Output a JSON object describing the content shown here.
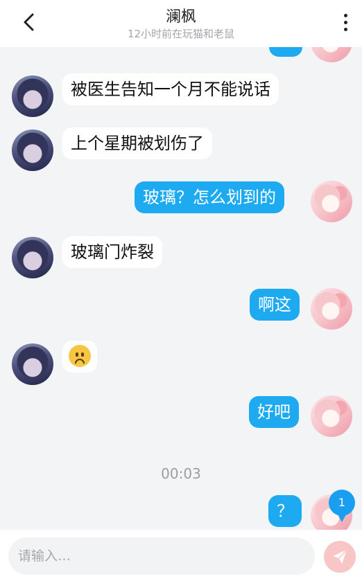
{
  "header": {
    "title": "澜枫",
    "subtitle": "12小时前在玩猫和老鼠",
    "back_icon": "chevron-left-icon",
    "more_icon": "more-vertical-icon"
  },
  "messages": [
    {
      "side": "out",
      "text": ""
    },
    {
      "side": "in",
      "text": "被医生告知一个月不能说话"
    },
    {
      "side": "in",
      "text": "上个星期被划伤了"
    },
    {
      "side": "out",
      "text": "玻璃？怎么划到的"
    },
    {
      "side": "in",
      "text": "玻璃门炸裂"
    },
    {
      "side": "out",
      "text": "啊这"
    },
    {
      "side": "in",
      "emoji": "worried-face-emoji"
    },
    {
      "side": "out",
      "text": "好吧"
    },
    {
      "side": "out",
      "text": "？"
    }
  ],
  "timestamp": "00:03",
  "unread_badge": "1",
  "input": {
    "placeholder": "请输入…",
    "value": ""
  },
  "send_icon": "paper-plane-icon",
  "colors": {
    "outgoing_bubble": "#1eaaf1",
    "incoming_bubble": "#ffffff",
    "background": "#f3f4f6",
    "badge": "#1a9ff0",
    "send_button": "#f8c6c6"
  }
}
